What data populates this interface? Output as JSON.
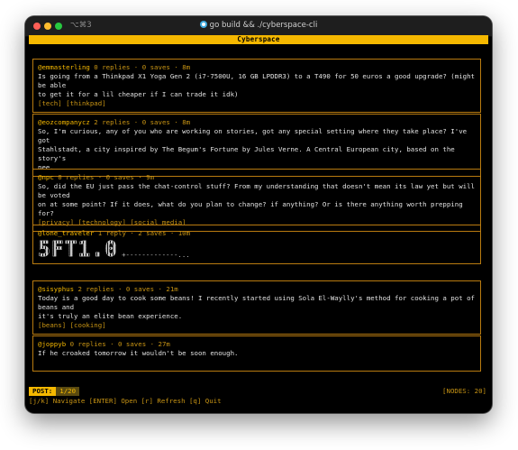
{
  "window": {
    "shortcut": "⌥⌘3",
    "title": "go build && ./cyberspace-cli"
  },
  "app": {
    "title": "Cyberspace"
  },
  "posts": [
    {
      "author": "@emmasterling",
      "meta": " 0 replies · 0 saves · 8m",
      "lines": [
        "Is going from a Thinkpad X1 Yoga Gen 2 (i7-7500U, 16 GB LPDDR3) to a T490 for 50 euros a good upgrade? (might be able",
        "to get it for a lil cheaper if I can trade it idk)"
      ],
      "tags": "[tech] [thinkpad]"
    },
    {
      "author": "@eozcompanycz",
      "meta": " 2 replies · 0 saves · 8m",
      "lines": [
        "So, I'm curious, any of you who are working on stories, got any special setting where they take place? I've got",
        "Stahlstadt, a city inspired by The Begum's Fortune by Jules Verne. A Central European city, based on the story's",
        "nee..."
      ],
      "tags": ""
    },
    {
      "author": "@npc",
      "meta": " 0 replies · 0 saves · 9m",
      "lines": [
        "So, did the EU just pass the chat-control stuff? From my understanding that doesn't mean its law yet but will be voted",
        "on at some point? If it does, what do you plan to change? if anything? Or is there anything worth prepping for?"
      ],
      "tags": "[privacy] [technology] [social media]"
    },
    {
      "author": "@lone_traveler",
      "meta": " 1 reply · 2 saves · 10m",
      "ascii_art": "5FT1.0",
      "ascii_tail": "+-------------...",
      "lines": [],
      "tags": ""
    },
    {
      "author": "@sisyphus",
      "meta": " 2 replies · 0 saves · 21m",
      "lines": [
        "Today is a good day to cook some beans! I recently started using Sola El-Waylly's method for cooking a pot of beans and",
        "it's truly an elite bean experience."
      ],
      "tags": "[beans] [cooking]"
    },
    {
      "author": "@joppyb",
      "meta": " 0 replies · 0 saves · 27m",
      "lines": [
        "If he croaked tomorrow it wouldn't be soon enough."
      ],
      "tags": ""
    }
  ],
  "status": {
    "post_label": "POST:",
    "post_count": "1/20",
    "nodes": "[NODES: 20]"
  },
  "help": "[j/k] Navigate  [ENTER] Open  [r] Refresh  [q] Quit",
  "colors": {
    "accent": "#f5b800",
    "border": "#b97b10",
    "background": "#000000"
  }
}
